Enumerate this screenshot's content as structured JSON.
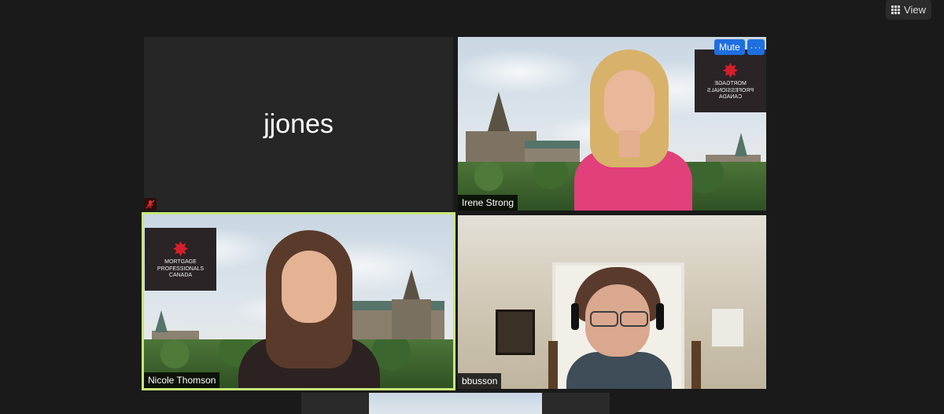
{
  "toolbar": {
    "view_label": "View"
  },
  "participants": [
    {
      "name": "jjones",
      "has_video": false,
      "muted": true
    },
    {
      "name": "Irene Strong",
      "has_video": true,
      "hover_actions": {
        "mute_label": "Mute",
        "more_label": "···"
      }
    },
    {
      "name": "Nicole Thomson",
      "has_video": true,
      "active_speaker": true
    },
    {
      "name": "bbusson",
      "has_video": true
    }
  ],
  "logos": {
    "irene": {
      "lines": [
        "MORTGAGE",
        "PROFESSIONALS",
        "CANADA"
      ]
    },
    "nicole": {
      "lines": [
        "MORTGAGE",
        "PROFESSIONALS",
        "CANADA"
      ]
    }
  },
  "colors": {
    "active_speaker_border": "#c8e77a",
    "button_blue": "#1f6fe0",
    "logo_red": "#d61f2c"
  }
}
